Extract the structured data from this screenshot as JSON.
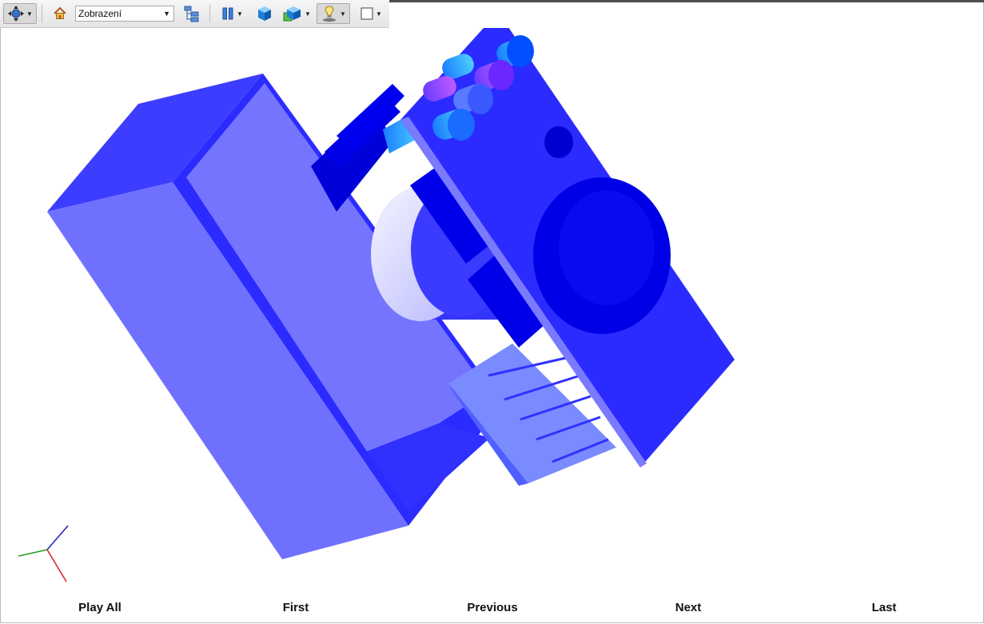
{
  "toolbar": {
    "view_select_value": "Zobrazení"
  },
  "icons": {
    "navigate": "move-arrows-icon",
    "home": "home-icon",
    "tree": "structure-tree-icon",
    "pause": "pause-icon",
    "cube": "cube-icon",
    "render_mode": "render-mode-icon",
    "lighting": "lighting-icon",
    "background": "background-color-icon"
  },
  "colors": {
    "model_primary": "#2b2bff",
    "model_light": "#7070ff",
    "model_dark": "#0000f0",
    "accent_cyan": "#2aa0ff",
    "accent_violet": "#9a5cff"
  },
  "nav": {
    "play_all": "Play All",
    "first": "First",
    "previous": "Previous",
    "next": "Next",
    "last": "Last"
  }
}
